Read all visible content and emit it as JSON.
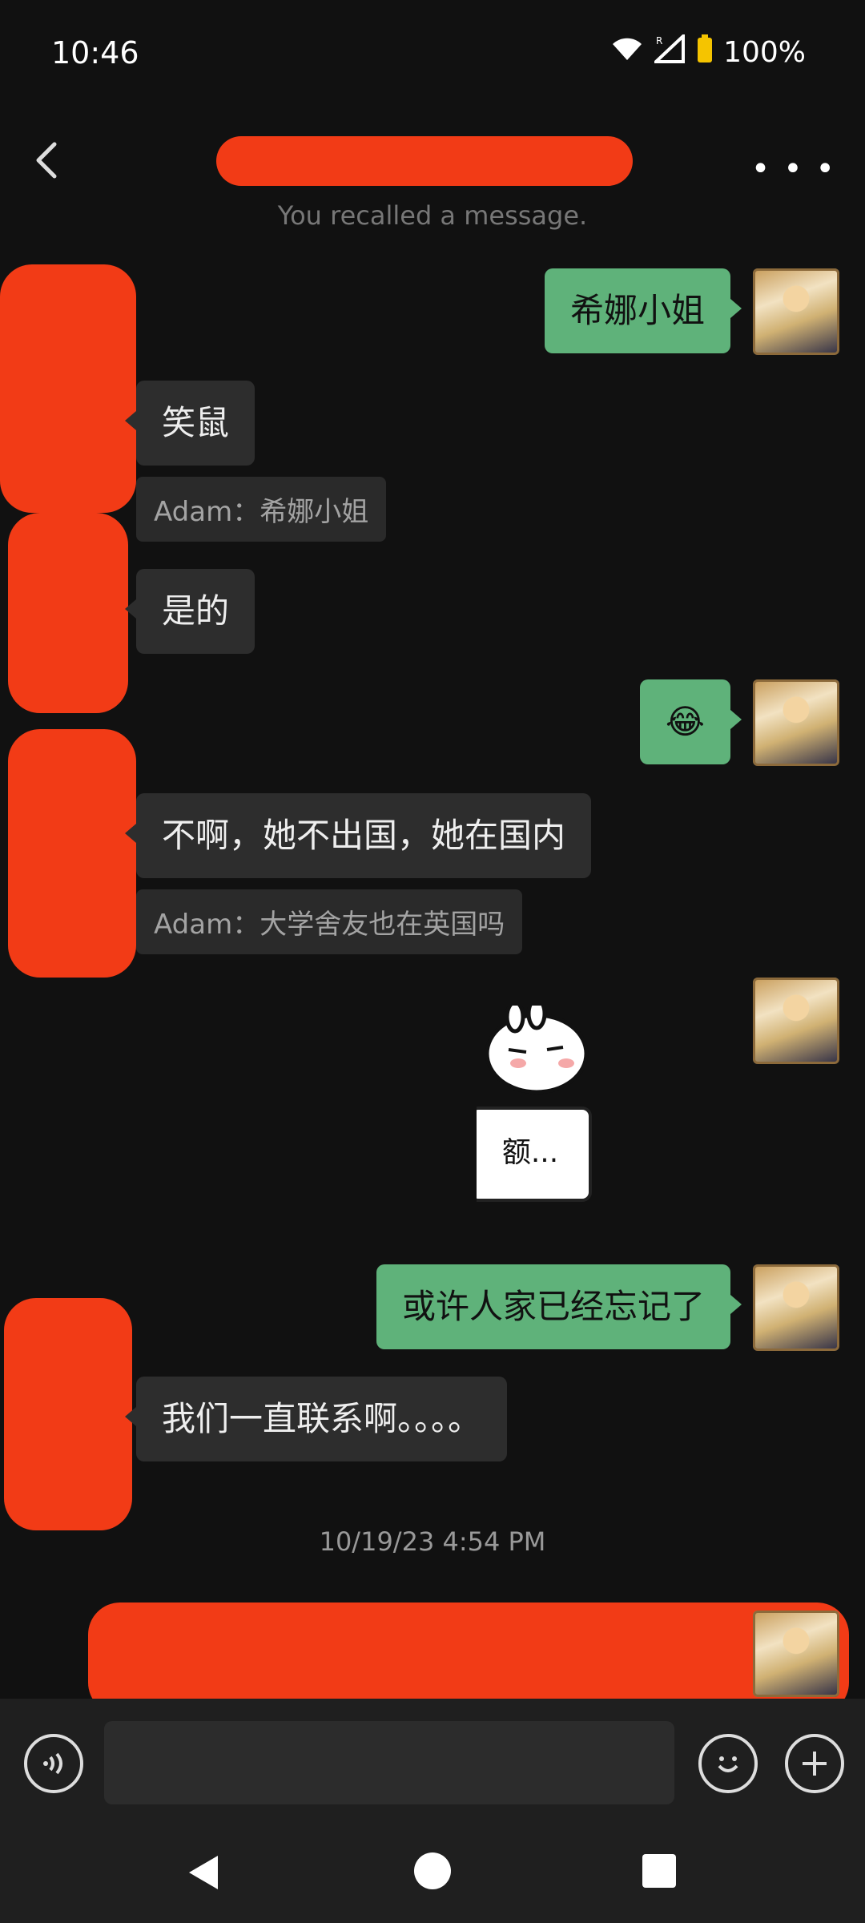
{
  "status": {
    "time": "10:46",
    "battery": "100%"
  },
  "header": {
    "more_label": "• • •"
  },
  "recalled": "You recalled a message.",
  "messages": {
    "m1": "希娜小姐",
    "m2": "笑鼠",
    "q1": "Adam：希娜小姐",
    "m3": "是的",
    "m4": "😂",
    "m5": "不啊，她不出国，她在国内",
    "q2": "Adam：大学舍友也在英国吗",
    "m6": "或许人家已经忘记了",
    "m7": "我们一直联系啊。。。。"
  },
  "sticker_text": "额...",
  "timestamp": "10/19/23 4:54 PM",
  "icons": {
    "voice": "voice-icon",
    "emoji": "emoji-icon",
    "plus": "plus-icon",
    "back": "back-arrow-icon",
    "more": "more-icon"
  }
}
